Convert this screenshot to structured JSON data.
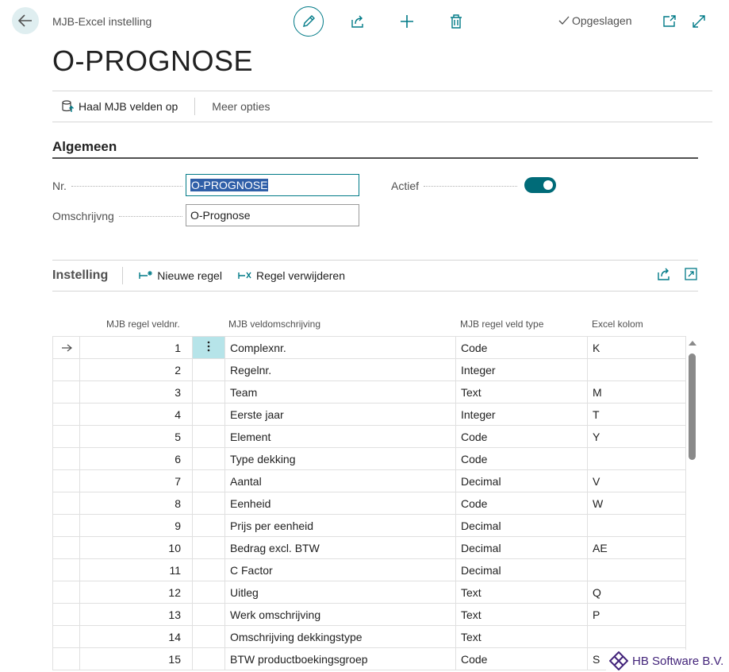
{
  "header": {
    "breadcrumb": "MJB-Excel instelling",
    "saved_status": "Opgeslagen",
    "title": "O-PROGNOSE"
  },
  "actions": {
    "fetch_fields": "Haal MJB velden op",
    "more_options": "Meer opties"
  },
  "general": {
    "section_title": "Algemeen",
    "nr_label": "Nr.",
    "nr_value": "O-PROGNOSE",
    "description_label": "Omschrijvng",
    "description_value": "O-Prognose",
    "active_label": "Actief",
    "active_value": true
  },
  "lines": {
    "title": "Instelling",
    "new_line": "Nieuwe regel",
    "delete_line": "Regel verwijderen",
    "columns": {
      "field_no": "MJB regel veldnr.",
      "field_description": "MJB veldomschrijving",
      "field_type": "MJB regel veld type",
      "excel_column": "Excel kolom"
    },
    "rows": [
      {
        "no": "1",
        "description": "Complexnr.",
        "type": "Code",
        "excel": "K"
      },
      {
        "no": "2",
        "description": "Regelnr.",
        "type": "Integer",
        "excel": ""
      },
      {
        "no": "3",
        "description": "Team",
        "type": "Text",
        "excel": "M"
      },
      {
        "no": "4",
        "description": "Eerste jaar",
        "type": "Integer",
        "excel": "T"
      },
      {
        "no": "5",
        "description": "Element",
        "type": "Code",
        "excel": "Y"
      },
      {
        "no": "6",
        "description": "Type dekking",
        "type": "Code",
        "excel": ""
      },
      {
        "no": "7",
        "description": "Aantal",
        "type": "Decimal",
        "excel": "V"
      },
      {
        "no": "8",
        "description": "Eenheid",
        "type": "Code",
        "excel": "W"
      },
      {
        "no": "9",
        "description": "Prijs per eenheid",
        "type": "Decimal",
        "excel": ""
      },
      {
        "no": "10",
        "description": "Bedrag excl. BTW",
        "type": "Decimal",
        "excel": "AE"
      },
      {
        "no": "11",
        "description": "C Factor",
        "type": "Decimal",
        "excel": ""
      },
      {
        "no": "12",
        "description": "Uitleg",
        "type": "Text",
        "excel": "Q"
      },
      {
        "no": "13",
        "description": "Werk omschrijving",
        "type": "Text",
        "excel": "P"
      },
      {
        "no": "14",
        "description": "Omschrijving dekkingstype",
        "type": "Text",
        "excel": ""
      },
      {
        "no": "15",
        "description": "BTW productboekingsgroep",
        "type": "Code",
        "excel": "S"
      }
    ]
  },
  "watermark": {
    "text": "HB Software B.V."
  },
  "colors": {
    "accent": "#007a87",
    "toggle_on": "#006b78",
    "selected_cell": "#b6e4e9",
    "watermark": "#43247a"
  }
}
